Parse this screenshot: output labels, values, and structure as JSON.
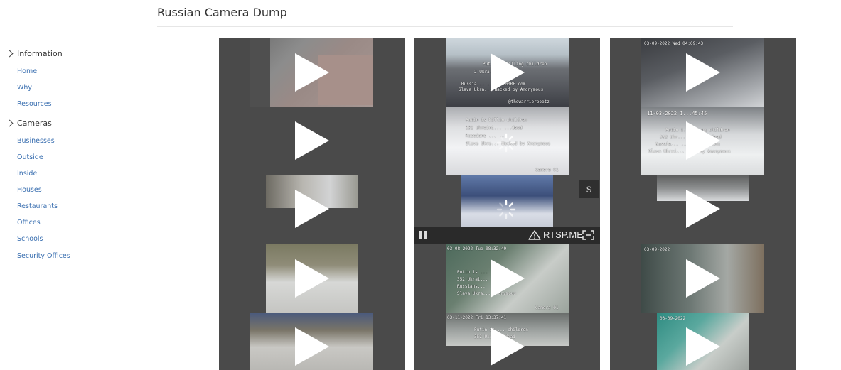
{
  "page": {
    "title": "Russian Camera Dump"
  },
  "sidebar": {
    "information": {
      "label": "Information",
      "items": [
        "Home",
        "Why",
        "Resources"
      ]
    },
    "cameras": {
      "label": "Cameras",
      "items": [
        "Businesses",
        "Outside",
        "Inside",
        "Houses",
        "Restaurants",
        "Offices",
        "Schools",
        "Security Offices"
      ]
    }
  },
  "player": {
    "brand": "RTSP.ME",
    "donate_label": "$"
  },
  "overlays": {
    "c1_t1": "",
    "c2_t1": [
      "Putin is killing children",
      "2 Ukra... ...dead",
      "Russia... ...to 200RF.com",
      "Slava Ukra... Hacked by Anonymous",
      "@thewarriorpoetz"
    ],
    "c2_t2": [
      "Putin is killin children",
      "352 Ukraini... ...dead",
      "Russians ... ...",
      "Slava Ukra... Hacked by Anonymous"
    ],
    "c2_t2b": "Camera 01",
    "c2_t4": [
      "03-08-2022 Tue 08:32:49",
      "Putin is ...",
      "352 Ukrai...",
      "Russians...",
      "Slava Ukra... Anonymous"
    ],
    "c2_t4b": "Camera 01",
    "c2_t5": [
      "03-11-2022 Fri 13:37:41",
      "Putin is ... children",
      "352 Ukra... dead"
    ],
    "c3_t1": "03-09-2022 Wed 04:09:43",
    "c3_t2": [
      "11-03-2022 1...45:45",
      "Putin i... ...ng children",
      "352 Ukr... ...lians dead",
      "Russia... ...to 200RF.com",
      "Slava Ukrai... ...d by Anonymous"
    ],
    "c3_t4": "03-09-2022",
    "c3_t5": "03-09-2022"
  }
}
